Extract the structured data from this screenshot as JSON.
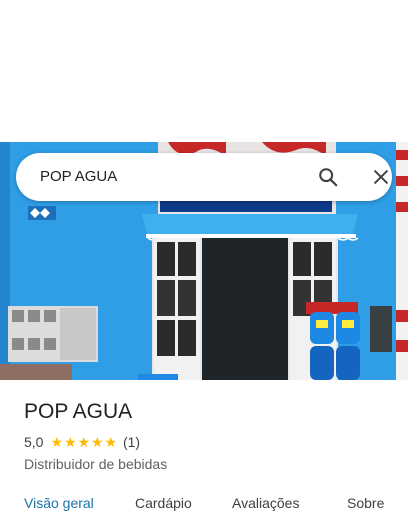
{
  "search": {
    "query": "POP AGUA",
    "search_icon": "search-icon",
    "close_icon": "close-icon"
  },
  "photo": {
    "description_icon": "storefront-photo"
  },
  "place": {
    "name": "POP AGUA",
    "rating": "5,0",
    "stars": 5,
    "review_count": "(1)",
    "category": "Distribuidor de bebidas"
  },
  "tabs": [
    {
      "label": "Visão geral",
      "active": true
    },
    {
      "label": "Cardápio",
      "active": false
    },
    {
      "label": "Avaliações",
      "active": false
    },
    {
      "label": "Sobre",
      "active": false
    }
  ],
  "colors": {
    "accent": "#1a73a8",
    "star": "#fbbc04",
    "wall": "#2f9ee6"
  }
}
